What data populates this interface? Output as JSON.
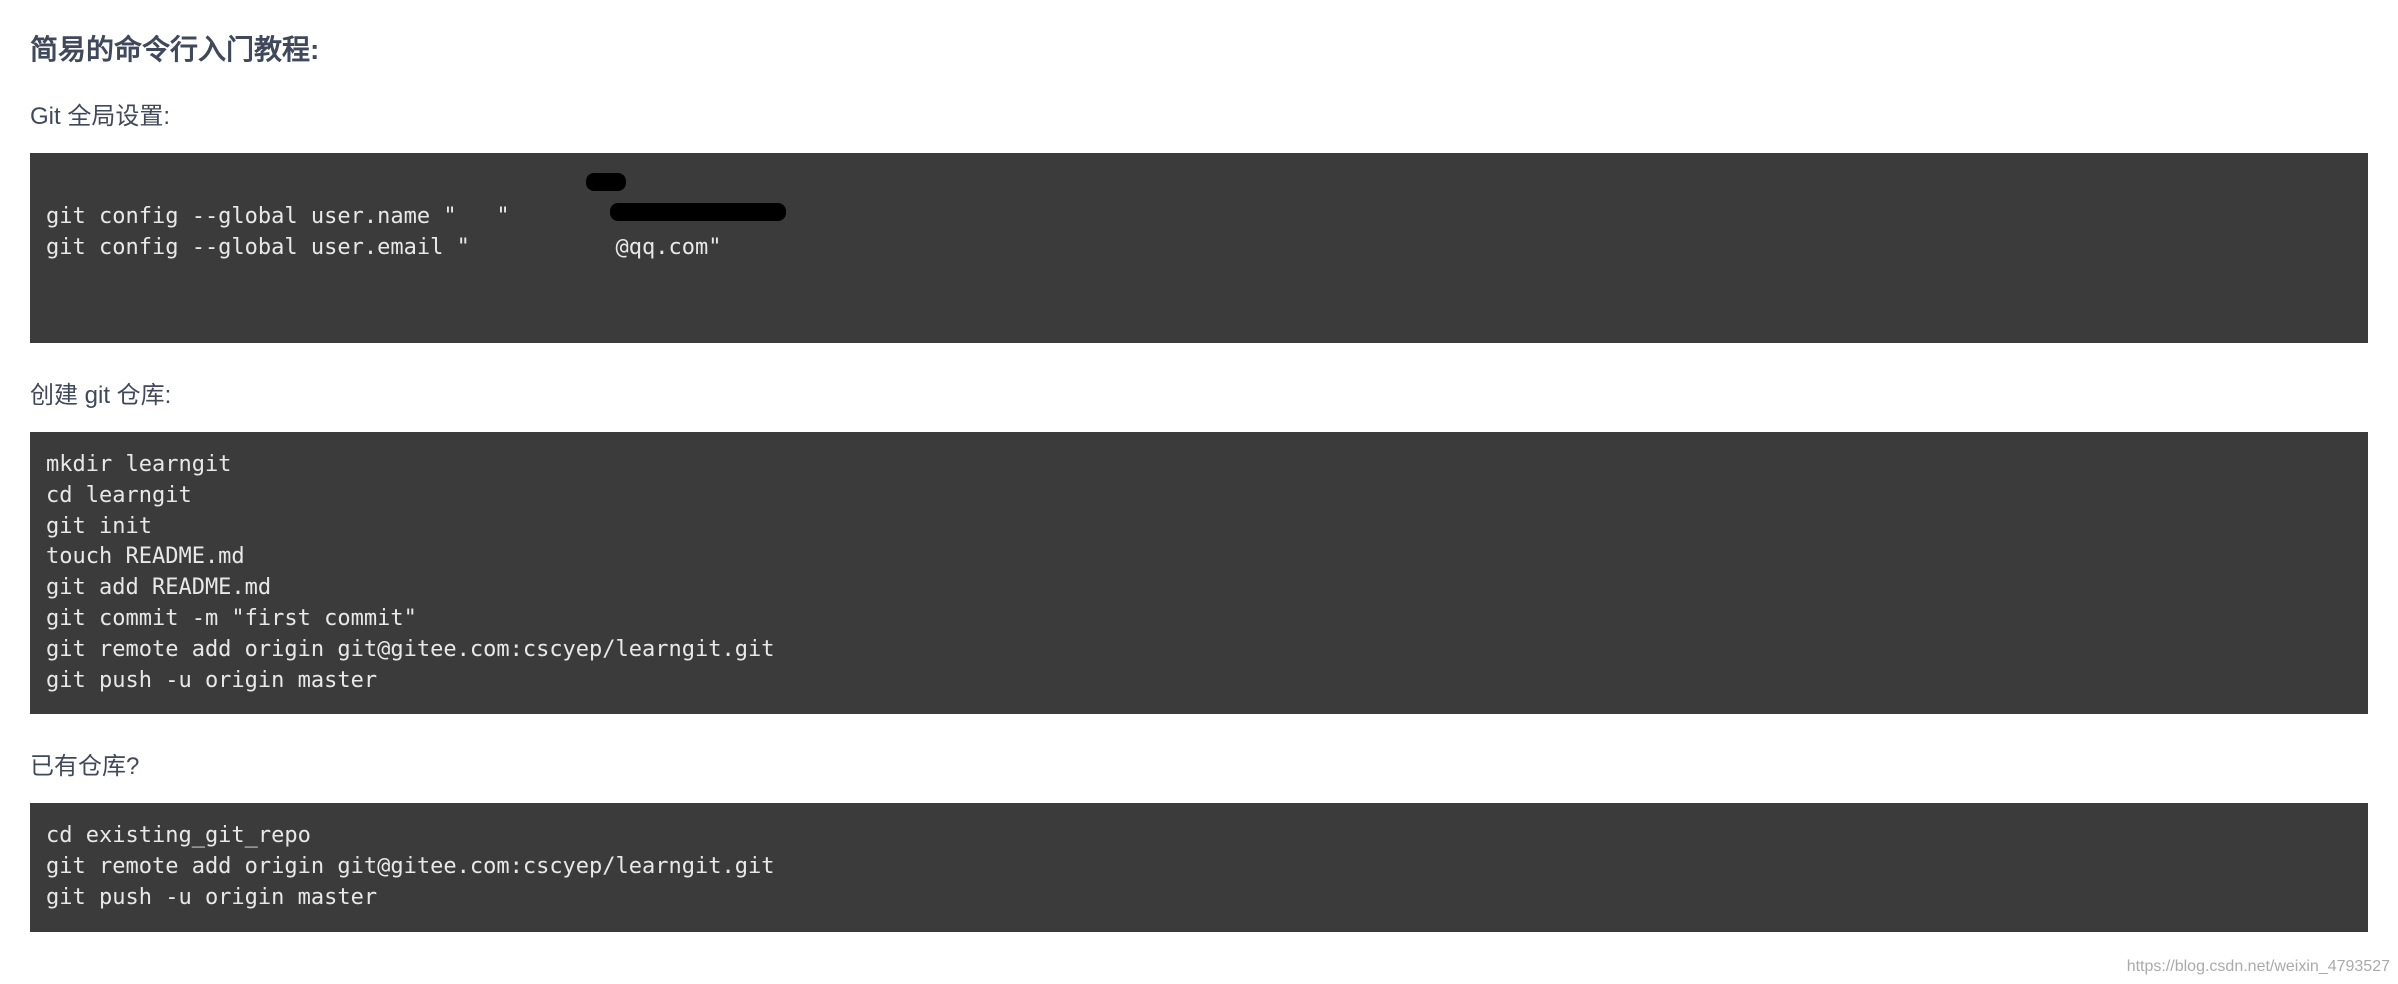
{
  "title": "简易的命令行入门教程:",
  "sections": [
    {
      "label": "Git 全局设置:",
      "code": "git config --global user.name \"   \"\ngit config --global user.email \"           @qq.com\""
    },
    {
      "label": "创建 git 仓库:",
      "code": "mkdir learngit\ncd learngit\ngit init\ntouch README.md\ngit add README.md\ngit commit -m \"first commit\"\ngit remote add origin git@gitee.com:cscyep/learngit.git\ngit push -u origin master"
    },
    {
      "label": "已有仓库?",
      "code": "cd existing_git_repo\ngit remote add origin git@gitee.com:cscyep/learngit.git\ngit push -u origin master"
    }
  ],
  "watermark": "https://blog.csdn.net/weixin_4793527"
}
